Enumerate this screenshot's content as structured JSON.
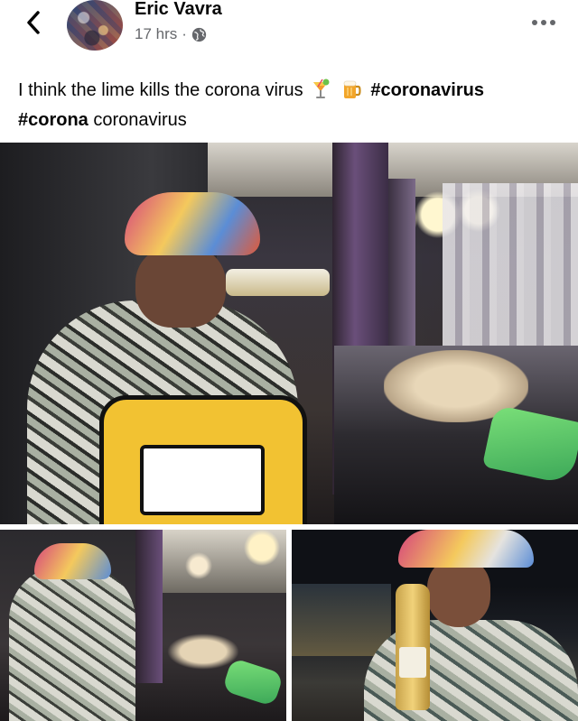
{
  "post": {
    "author": "Eric Vavra",
    "time": "17 hrs",
    "separator": "·",
    "audience_icon": "globe-icon"
  },
  "caption": {
    "text": "I think the lime kills the corona virus",
    "emoji_1": "tropical-drink-icon",
    "emoji_2": "beer-mug-icon",
    "hashtag_1": "#coronavirus",
    "hashtag_2": "#corona",
    "trailing": "coronavirus"
  },
  "toolbar": {
    "back_icon": "chevron-left-icon",
    "more_icon": "more-horizontal-icon"
  },
  "photos": {
    "count": 3
  }
}
